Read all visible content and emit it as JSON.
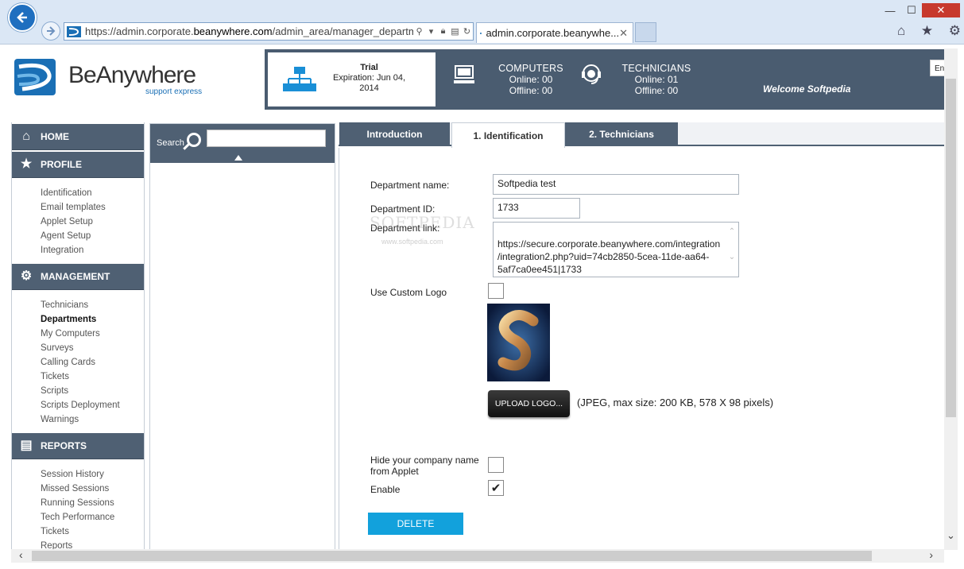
{
  "browser": {
    "url_prefix": "https://admin.corporate.",
    "url_domain": "beanywhere.com",
    "url_path": "/admin_area/manager_departmen",
    "tab_title": "admin.corporate.beanywhe...",
    "tab_close": "✕",
    "window": {
      "minimize": "—",
      "maximize": "☐",
      "close": "✕"
    }
  },
  "header": {
    "brand_be": "Be",
    "brand_anywhere": "Anywhere",
    "brand_sub": "support express",
    "trial_title": "Trial",
    "trial_expiration": "Expiration: Jun 04, 2014",
    "computers_label": "COMPUTERS",
    "computers_online": "Online: 00",
    "computers_offline": "Offline: 00",
    "technicians_label": "TECHNICIANS",
    "technicians_online": "Online: 01",
    "technicians_offline": "Offline: 00",
    "welcome": "Welcome Softpedia",
    "lang": "En"
  },
  "sidebar": {
    "home": "HOME",
    "profile": "PROFILE",
    "profile_items": [
      "Identification",
      "Email templates",
      "Applet Setup",
      "Agent Setup",
      "Integration"
    ],
    "management": "MANAGEMENT",
    "management_items": [
      "Technicians",
      "Departments",
      "My Computers",
      "Surveys",
      "Calling Cards",
      "Tickets",
      "Scripts",
      "Scripts Deployment",
      "Warnings"
    ],
    "reports": "REPORTS",
    "reports_items": [
      "Session History",
      "Missed Sessions",
      "Running Sessions",
      "Tech Performance",
      "Tickets",
      "Reports"
    ]
  },
  "search": {
    "label": "Search",
    "value": ""
  },
  "tabs": [
    "Introduction",
    "1. Identification",
    "2. Technicians"
  ],
  "form": {
    "dept_name_label": "Department name:",
    "dept_name_value": "Softpedia test",
    "dept_id_label": "Department ID:",
    "dept_id_value": "1733",
    "dept_link_label": "Department link:",
    "dept_link_value": "https://secure.corporate.beanywhere.com/integration\n/integration2.php?uid=74cb2850-5cea-11de-aa64-\n5af7ca0ee451|1733",
    "custom_logo_label": "Use Custom Logo",
    "upload_button": "UPLOAD LOGO...",
    "upload_hint": "(JPEG, max size: 200 KB, 578 X 98 pixels)",
    "hide_company_label_1": "Hide your company name",
    "hide_company_label_2": "from Applet",
    "enable_label": "Enable",
    "enable_checked": "✔",
    "delete_button": "DELETE"
  },
  "watermark": {
    "main": "SOFTPEDIA",
    "sub": "www.softpedia.com"
  },
  "colors": {
    "panel": "#4f6073",
    "header": "#4a5c70",
    "accent": "#12a1dc",
    "brand": "#1a6fb5"
  }
}
